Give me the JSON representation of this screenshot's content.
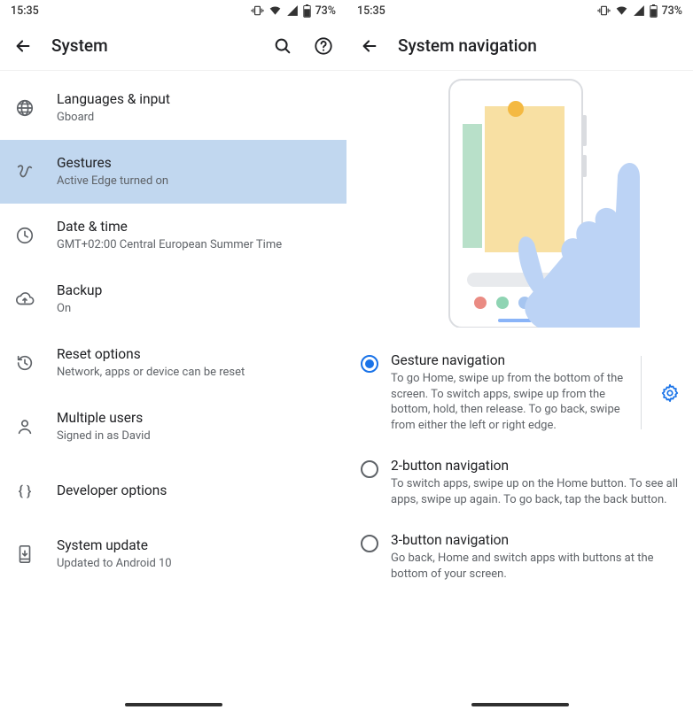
{
  "status": {
    "time": "15:35",
    "battery": "73%"
  },
  "paneA": {
    "title": "System",
    "items": [
      {
        "icon": "globe",
        "title": "Languages & input",
        "subtitle": "Gboard"
      },
      {
        "icon": "gesture",
        "title": "Gestures",
        "subtitle": "Active Edge turned on",
        "highlighted": true
      },
      {
        "icon": "clock",
        "title": "Date & time",
        "subtitle": "GMT+02:00 Central European Summer Time"
      },
      {
        "icon": "backup",
        "title": "Backup",
        "subtitle": "On"
      },
      {
        "icon": "restore",
        "title": "Reset options",
        "subtitle": "Network, apps or device can be reset"
      },
      {
        "icon": "person",
        "title": "Multiple users",
        "subtitle": "Signed in as David"
      },
      {
        "icon": "braces",
        "title": "Developer options",
        "subtitle": ""
      },
      {
        "icon": "system-update",
        "title": "System update",
        "subtitle": "Updated to Android 10"
      }
    ]
  },
  "paneB": {
    "title": "System navigation",
    "options": [
      {
        "title": "Gesture navigation",
        "desc": "To go Home, swipe up from the bottom of the screen. To switch apps, swipe up from the bottom, hold, then release. To go back, swipe from either the left or right edge.",
        "checked": true,
        "gear": true
      },
      {
        "title": "2-button navigation",
        "desc": "To switch apps, swipe up on the Home button. To see all apps, swipe up again. To go back, tap the back button.",
        "checked": false
      },
      {
        "title": "3-button navigation",
        "desc": "Go back, Home and switch apps with buttons at the bottom of your screen.",
        "checked": false
      }
    ]
  }
}
